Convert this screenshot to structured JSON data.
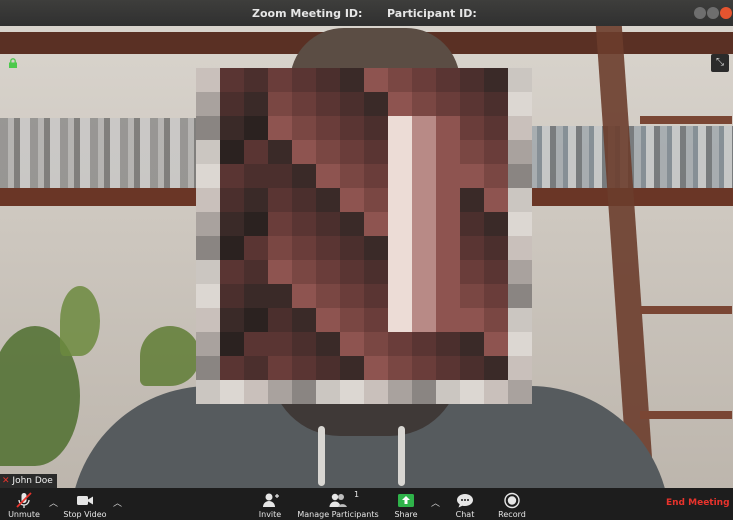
{
  "window": {
    "meeting_id_label": "Zoom Meeting ID:",
    "participant_id_label": "Participant ID:"
  },
  "video": {
    "participant_name": "John Doe"
  },
  "toolbar": {
    "unmute_label": "Unmute",
    "stop_video_label": "Stop Video",
    "invite_label": "Invite",
    "manage_participants_label": "Manage Participants",
    "participant_count": "1",
    "share_label": "Share",
    "chat_label": "Chat",
    "record_label": "Record",
    "end_meeting_label": "End Meeting"
  },
  "colors": {
    "end_meeting": "#e8332c",
    "share_accent": "#2fb34a",
    "lock_accent": "#4cc94c"
  },
  "icons": [
    "lock-icon",
    "fullscreen-icon",
    "muted-mic-icon",
    "video-camera-icon",
    "invite-icon",
    "participants-icon",
    "share-screen-icon",
    "chat-icon",
    "record-icon"
  ]
}
